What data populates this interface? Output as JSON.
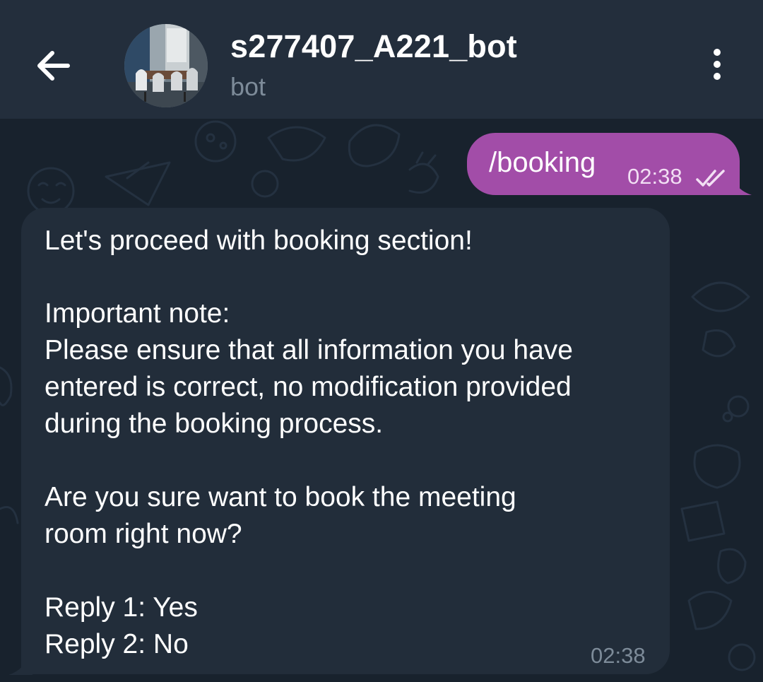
{
  "header": {
    "title": "s277407_A221_bot",
    "subtitle": "bot",
    "back_icon": "arrow-left-icon",
    "menu_icon": "more-vertical-icon"
  },
  "messages": {
    "outgoing": {
      "text": "/booking",
      "time": "02:38",
      "status_icon": "double-check-icon"
    },
    "incoming": {
      "lines": [
        "Let's proceed with booking section!",
        "",
        "Important note:",
        "Please ensure that all information you have",
        "entered is correct, no modification provided",
        "during the booking process.",
        "",
        "Are you sure want to book the meeting",
        "room right now?",
        "",
        "Reply 1: Yes",
        "Reply 2: No"
      ],
      "time": "02:38"
    }
  },
  "colors": {
    "header_bg": "#232e3c",
    "chat_bg": "#18222d",
    "outgoing_bubble": "#a24da8",
    "incoming_bubble": "#222d3a",
    "secondary_text": "#7d8b99"
  }
}
